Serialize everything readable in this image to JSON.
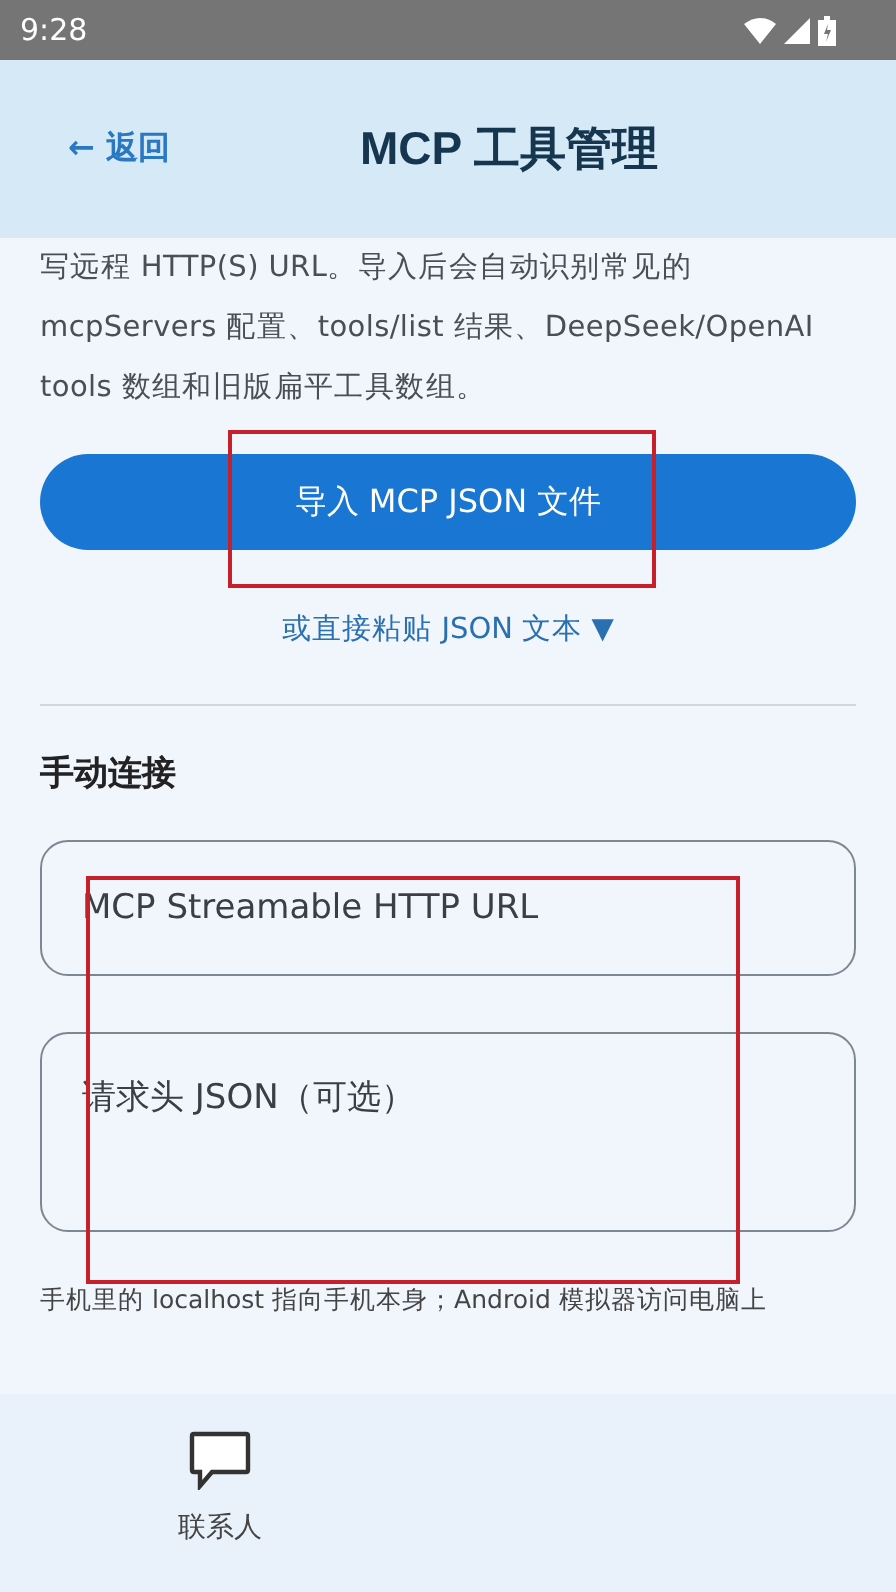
{
  "status_bar": {
    "time": "9:28"
  },
  "header": {
    "back": "← 返回",
    "title": "MCP 工具管理"
  },
  "intro": "写远程 HTTP(S) URL。导入后会自动识别常见的 mcpServers 配置、tools/list 结果、DeepSeek/OpenAI tools 数组和旧版扁平工具数组。",
  "import_button": "导入 MCP JSON 文件",
  "paste_link": "或直接粘贴 JSON 文本 ▼",
  "manual": {
    "heading": "手动连接",
    "fields": [
      {
        "placeholder": "MCP Streamable HTTP URL",
        "kind": "single"
      },
      {
        "placeholder": "请求头 JSON（可选）",
        "kind": "multi"
      }
    ]
  },
  "hint": "手机里的 localhost 指向手机本身；Android 模拟器访问电脑上",
  "bottom_nav": [
    {
      "label": "联系人"
    }
  ]
}
